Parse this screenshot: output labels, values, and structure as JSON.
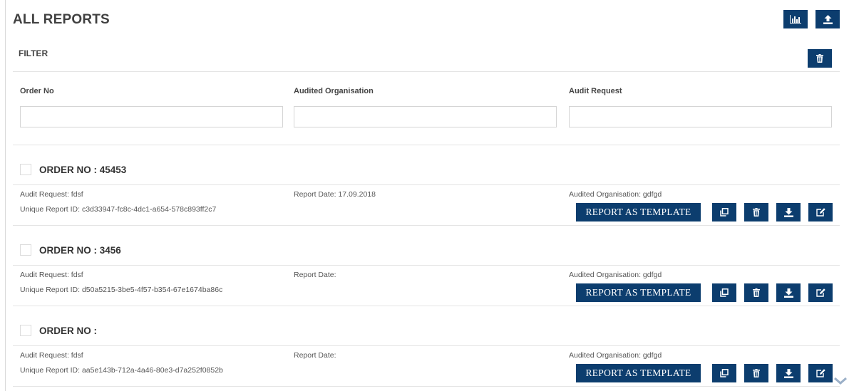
{
  "header": {
    "title": "ALL REPORTS"
  },
  "filter": {
    "title": "FILTER",
    "fields": [
      {
        "label": "Order No",
        "value": ""
      },
      {
        "label": "Audited Organisation",
        "value": ""
      },
      {
        "label": "Audit Request",
        "value": ""
      }
    ]
  },
  "reports": [
    {
      "order_no": "ORDER NO : 45453",
      "audit_request": "Audit Request: fdsf",
      "unique_id": "Unique Report ID: c3d33947-fc8c-4dc1-a654-578c893ff2c7",
      "report_date": "Report Date: 17.09.2018",
      "audited_org": "Audited Organisation: gdfgd",
      "template_label": "REPORT AS TEMPLATE"
    },
    {
      "order_no": "ORDER NO : 3456",
      "audit_request": "Audit Request: fdsf",
      "unique_id": "Unique Report ID: d50a5215-3be5-4f57-b354-67e1674ba86c",
      "report_date": "Report Date:",
      "audited_org": "Audited Organisation: gdfgd",
      "template_label": "REPORT AS TEMPLATE"
    },
    {
      "order_no": "ORDER NO :",
      "audit_request": "Audit Request: fdsf",
      "unique_id": "Unique Report ID: aa5e143b-712a-4a46-80e3-d7a252f0852b",
      "report_date": "Report Date:",
      "audited_org": "Audited Organisation: gdfgd",
      "template_label": "REPORT AS TEMPLATE"
    }
  ],
  "icons": {
    "chart": "bar-chart-icon",
    "upload": "upload-icon",
    "trash": "trash-icon",
    "copy": "copy-icon",
    "download": "download-icon",
    "edit": "edit-icon",
    "chevron": "chevron-down-icon"
  },
  "colors": {
    "primary": "#0c3d6e",
    "border": "#e4e4e4",
    "chevron": "#9bb0c8"
  }
}
